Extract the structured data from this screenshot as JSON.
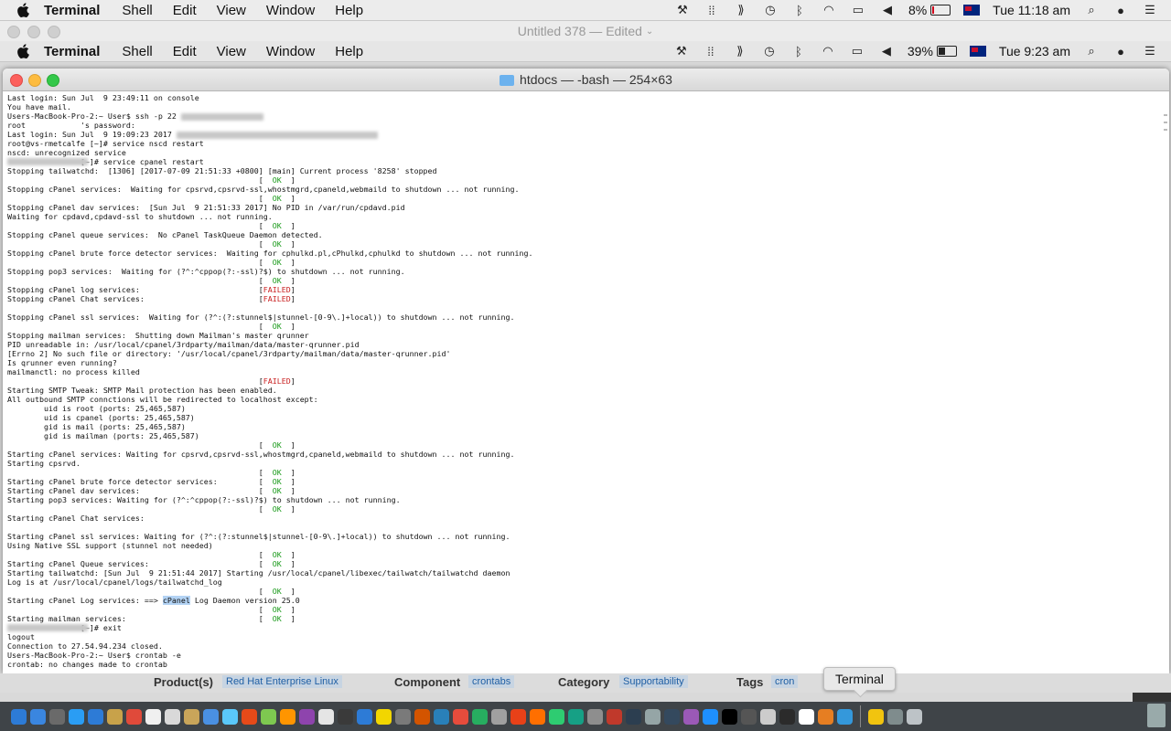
{
  "menubar_outer": {
    "app": "Terminal",
    "items": [
      "Shell",
      "Edit",
      "View",
      "Window",
      "Help"
    ],
    "battery": "8%",
    "clock": "Tue 11:18 am"
  },
  "docbar": {
    "title": "Untitled 378 — Edited"
  },
  "menubar_inner": {
    "app": "Terminal",
    "items": [
      "Shell",
      "Edit",
      "View",
      "Window",
      "Help"
    ],
    "battery": "39%",
    "clock": "Tue 9:23 am"
  },
  "window": {
    "title": "htdocs — -bash — 254×63"
  },
  "terminal": {
    "lines": [
      "Last login: Sun Jul  9 23:49:11 on console",
      "You have mail.",
      "Users-MacBook-Pro-2:~ User$ ssh -p 22 ",
      "root            's password:",
      "Last login: Sun Jul  9 19:09:23 2017 ",
      "root@vs-rmetcalfe [~]# service nscd restart",
      "nscd: unrecognized service",
      "                [~]# service cpanel restart",
      "Stopping tailwatchd:  [1306] [2017-07-09 21:51:33 +0800] [main] Current process '8258' stopped",
      "                                                       [  OK  ]",
      "Stopping cPanel services:  Waiting for cpsrvd,cpsrvd-ssl,whostmgrd,cpaneld,webmaild to shutdown ... not running.",
      "                                                       [  OK  ]",
      "Stopping cPanel dav services:  [Sun Jul  9 21:51:33 2017] No PID in /var/run/cpdavd.pid",
      "Waiting for cpdavd,cpdavd-ssl to shutdown ... not running.",
      "                                                       [  OK  ]",
      "Stopping cPanel queue services:  No cPanel TaskQueue Daemon detected.",
      "                                                       [  OK  ]",
      "Stopping cPanel brute force detector services:  Waiting for cphulkd.pl,cPhulkd,cphulkd to shutdown ... not running.",
      "                                                       [  OK  ]",
      "Stopping pop3 services:  Waiting for (?^:^cppop(?:-ssl)?$) to shutdown ... not running.",
      "                                                       [  OK  ]",
      "Stopping cPanel log services:                          [FAILED]",
      "Stopping cPanel Chat services:                         [FAILED]",
      "",
      "Stopping cPanel ssl services:  Waiting for (?^:(?:stunnel$|stunnel-[0-9\\.]+local)) to shutdown ... not running.",
      "                                                       [  OK  ]",
      "Stopping mailman services:  Shutting down Mailman's master qrunner",
      "PID unreadable in: /usr/local/cpanel/3rdparty/mailman/data/master-qrunner.pid",
      "[Errno 2] No such file or directory: '/usr/local/cpanel/3rdparty/mailman/data/master-qrunner.pid'",
      "Is qrunner even running?",
      "mailmanctl: no process killed",
      "                                                       [FAILED]",
      "Starting SMTP Tweak: SMTP Mail protection has been enabled.",
      "All outbound SMTP connctions will be redirected to localhost except:",
      "        uid is root (ports: 25,465,587)",
      "        uid is cpanel (ports: 25,465,587)",
      "        gid is mail (ports: 25,465,587)",
      "        gid is mailman (ports: 25,465,587)",
      "                                                       [  OK  ]",
      "Starting cPanel services: Waiting for cpsrvd,cpsrvd-ssl,whostmgrd,cpaneld,webmaild to shutdown ... not running.",
      "Starting cpsrvd.",
      "                                                       [  OK  ]",
      "Starting cPanel brute force detector services:         [  OK  ]",
      "Starting cPanel dav services:                          [  OK  ]",
      "Starting pop3 services: Waiting for (?^:^cppop(?:-ssl)?$) to shutdown ... not running.",
      "                                                       [  OK  ]",
      "Starting cPanel Chat services:",
      "",
      "Starting cPanel ssl services: Waiting for (?^:(?:stunnel$|stunnel-[0-9\\.]+local)) to shutdown ... not running.",
      "Using Native SSL support (stunnel not needed)",
      "                                                       [  OK  ]",
      "Starting cPanel Queue services:                        [  OK  ]",
      "Starting tailwatchd: [Sun Jul  9 21:51:44 2017] Starting /usr/local/cpanel/libexec/tailwatch/tailwatchd daemon",
      "Log is at /usr/local/cpanel/logs/tailwatchd_log",
      "                                                       [  OK  ]",
      "Starting cPanel Log services: ==> cPanel Log Daemon version 25.0",
      "                                                       [  OK  ]",
      "Starting mailman services:                             [  OK  ]",
      "                [~]# exit",
      "logout",
      "Connection to 27.54.94.234 closed.",
      "Users-MacBook-Pro-2:~ User$ crontab -e",
      "crontab: no changes made to crontab"
    ]
  },
  "webstrip": {
    "products_label": "Product(s)",
    "products_value": "Red Hat Enterprise Linux",
    "component_label": "Component",
    "component_value": "crontabs",
    "category_label": "Category",
    "category_value": "Supportability",
    "tags_label": "Tags",
    "tags_value": "cron"
  },
  "tooltip": "Terminal",
  "colors": {
    "ok": "#1a9a1a",
    "failed": "#c81e1e",
    "link": "#1f5fa4"
  }
}
